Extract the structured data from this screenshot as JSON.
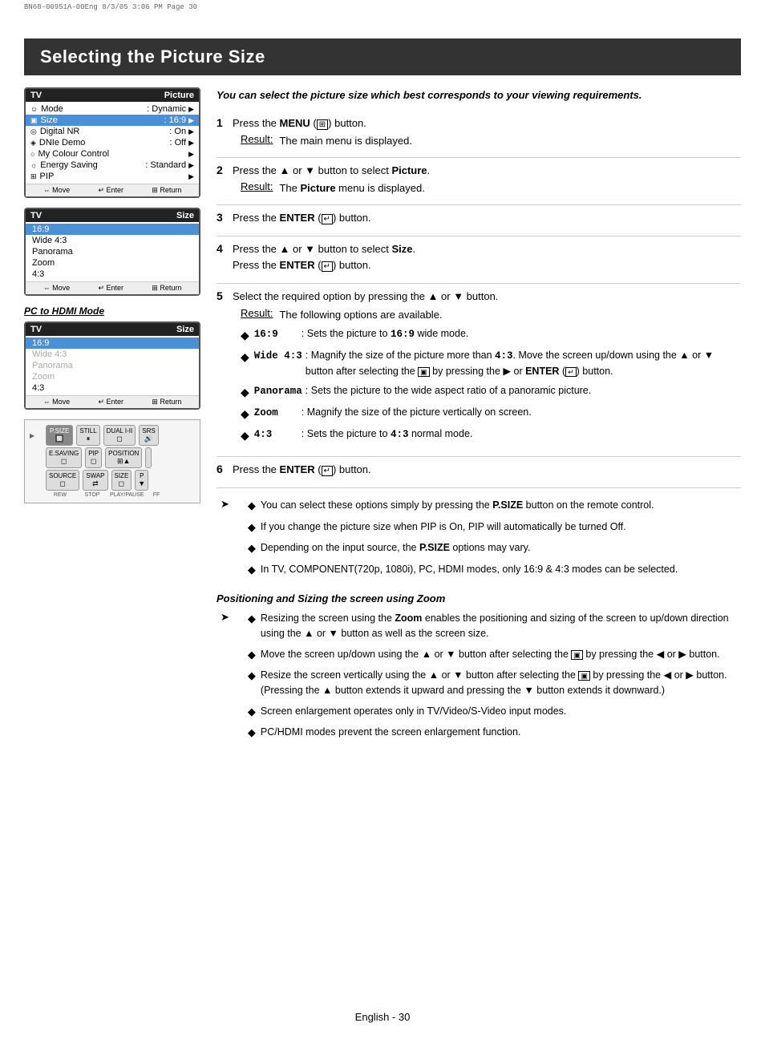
{
  "print_header": "BN68-00951A-00Eng   8/3/05   3:06 PM   Page 30",
  "page_title": "Selecting the Picture Size",
  "intro_text": "You can select the picture size which best corresponds to your viewing requirements.",
  "tv_screen1": {
    "header_left": "TV",
    "header_right": "Picture",
    "rows": [
      {
        "icon": "☺",
        "label": "Mode",
        "value": ": Dynamic",
        "has_arrow": true
      },
      {
        "icon": "",
        "label": "Size",
        "value": ": 16:9",
        "has_arrow": true,
        "selected": true
      },
      {
        "icon": "◎",
        "label": "Digital NR",
        "value": ": On",
        "has_arrow": true
      },
      {
        "icon": "",
        "label": "DNIe Demo",
        "value": ": Off",
        "has_arrow": true
      },
      {
        "icon": "○",
        "label": "My Colour Control",
        "value": "",
        "has_arrow": true
      },
      {
        "icon": "☼",
        "label": "Energy Saving",
        "value": ": Standard",
        "has_arrow": true
      },
      {
        "icon": "⊞",
        "label": "PIP",
        "value": "",
        "has_arrow": true
      }
    ],
    "footer": [
      "⇔ Move",
      "↵ Enter",
      "⊞ Return"
    ]
  },
  "tv_screen2": {
    "header_left": "TV",
    "header_right": "Size",
    "items": [
      "16:9",
      "Wide 4:3",
      "Panorama",
      "Zoom",
      "4:3"
    ],
    "selected": "16:9",
    "footer": [
      "⇔ Move",
      "↵ Enter",
      "⊞ Return"
    ]
  },
  "pc_hdmi_label": "PC to HDMI Mode",
  "tv_screen3": {
    "header_left": "TV",
    "header_right": "Size",
    "items": [
      "16:9",
      "Wide 4:3",
      "Panorama",
      "Zoom",
      "4:3"
    ],
    "selected": "16:9",
    "footer": [
      "⇔ Move",
      "↵ Enter",
      "⊞ Return"
    ]
  },
  "remote": {
    "row1_labels": [
      "P.SIZE",
      "STILL",
      "DUAL I-II",
      "SRS"
    ],
    "row2_labels": [
      "E.SAVING",
      "PIP",
      "POSITION",
      ""
    ],
    "row3_labels": [
      "SOURCE",
      "SWAP",
      "SIZE",
      "P"
    ],
    "row4_labels": [
      "REW",
      "STOP",
      "PLAY/PAUSE",
      "FF"
    ]
  },
  "steps": [
    {
      "num": "1",
      "text": "Press the MENU (  ) button.",
      "result_label": "Result:",
      "result_text": "The main menu is displayed."
    },
    {
      "num": "2",
      "text": "Press the ▲ or ▼ button to select Picture.",
      "result_label": "Result:",
      "result_text": "The Picture menu is displayed."
    },
    {
      "num": "3",
      "text": "Press the ENTER (↵) button."
    },
    {
      "num": "4",
      "text": "Press the ▲ or ▼ button to select Size. Press the ENTER (↵) button."
    },
    {
      "num": "5",
      "text": "Select the required option by pressing the ▲ or ▼ button.",
      "result_label": "Result:",
      "result_text": "The following options are available.",
      "options": [
        {
          "label": "16:9",
          "desc": ": Sets the picture to 16:9 wide mode."
        },
        {
          "label": "Wide 4:3",
          "desc": ": Magnify the size of the picture more than 4:3. Move the screen up/down using the ▲ or ▼ button after selecting the  ▣  by pressing the ▶ or ENTER (↵) button."
        },
        {
          "label": "Panorama",
          "desc": ": Sets the picture to the wide aspect ratio of a panoramic picture."
        },
        {
          "label": "Zoom",
          "desc": ": Magnify the size of the picture vertically on screen."
        },
        {
          "label": "4:3",
          "desc": ": Sets the picture to 4:3 normal mode."
        }
      ]
    },
    {
      "num": "6",
      "text": "Press the ENTER (↵) button."
    }
  ],
  "notes": [
    "You can select these options simply by pressing the P.SIZE button on the remote control.",
    "If you change the picture size when PIP is On, PIP will automatically be turned Off.",
    "Depending on the input source, the P.SIZE options may vary.",
    "In TV, COMPONENT(720p, 1080i), PC, HDMI modes, only 16:9 & 4:3 modes can be selected."
  ],
  "positioning_header": "Positioning and Sizing the screen using Zoom",
  "positioning_notes": [
    "Resizing the screen using the Zoom enables the positioning and sizing of the screen to up/down direction using the ▲ or ▼ button as well as the screen size.",
    "Move the screen up/down using the ▲ or ▼ button after selecting the  ▣  by pressing the ◀ or ▶ button.",
    "Resize the screen vertically using the ▲ or ▼ button after selecting the  ▣  by pressing the ◀ or ▶ button. (Pressing the ▲ button extends it upward and pressing the ▼ button extends it downward.)",
    "Screen enlargement operates only in TV/Video/S-Video input modes.",
    "PC/HDMI modes prevent the screen enlargement function."
  ],
  "footer": {
    "text": "English - 30"
  }
}
